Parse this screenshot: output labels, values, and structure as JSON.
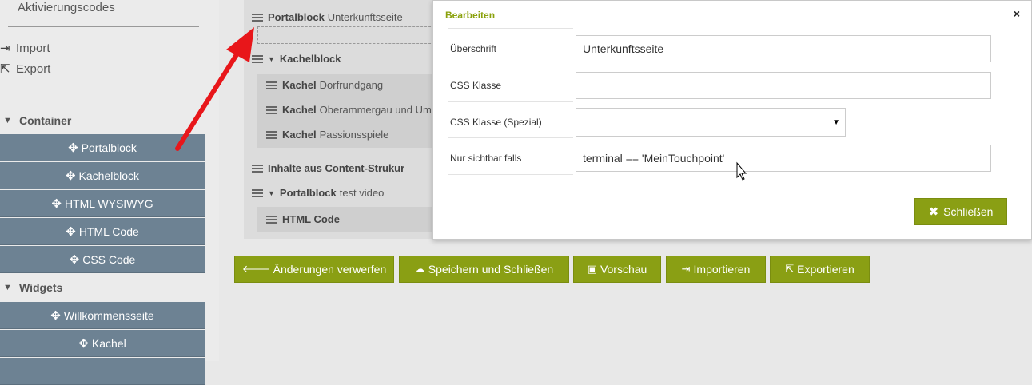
{
  "sidebar": {
    "activation_codes": "Aktivierungscodes",
    "import": "Import",
    "export": "Export",
    "container_heading": "Container",
    "container_items": [
      "Portalblock",
      "Kachelblock",
      "HTML WYSIWYG",
      "HTML Code",
      "CSS Code"
    ],
    "widgets_heading": "Widgets",
    "widget_items": [
      "Willkommensseite",
      "Kachel"
    ]
  },
  "tree": {
    "portalblock_1": {
      "type": "Portalblock",
      "name": "Unterkunftsseite"
    },
    "kachelblock": {
      "type": "Kachelblock"
    },
    "kacheln": [
      {
        "type": "Kachel",
        "name": "Dorfrundgang"
      },
      {
        "type": "Kachel",
        "name": "Oberammergau und Umge"
      },
      {
        "type": "Kachel",
        "name": "Passionsspiele"
      }
    ],
    "content_struct": {
      "type": "Inhalte aus Content-Strukur"
    },
    "portalblock_2": {
      "type": "Portalblock",
      "name": "test video"
    },
    "html_code": {
      "type": "HTML Code"
    }
  },
  "modal": {
    "title": "Bearbeiten",
    "close_symbol": "×",
    "fields": {
      "heading_label": "Überschrift",
      "heading_value": "Unterkunftsseite",
      "css_label": "CSS Klasse",
      "css_value": "",
      "css_special_label": "CSS Klasse (Spezial)",
      "css_special_value": "",
      "visible_label": "Nur sichtbar falls",
      "visible_value": "terminal == 'MeinTouchpoint'"
    },
    "close_button": "Schließen"
  },
  "toolbar": {
    "discard": "Änderungen verwerfen",
    "save_close": "Speichern und Schließen",
    "preview": "Vorschau",
    "import": "Importieren",
    "export": "Exportieren"
  },
  "colors": {
    "accent": "#8a9f14",
    "sidebar_button": "#6d8293",
    "modal_title": "#8aa10c",
    "annotation_arrow": "#e8161a"
  }
}
